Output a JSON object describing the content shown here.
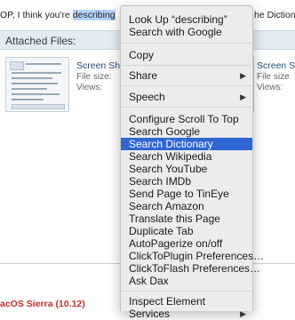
{
  "post": {
    "before": "OP, I think you're ",
    "highlight": "describing",
    "after": "he Dictiona"
  },
  "attached": {
    "header": "Attached Files:",
    "files": [
      {
        "name": "Screen Sh",
        "size_label": "File size:",
        "views_label": "Views:"
      },
      {
        "name": "Screen S",
        "size_label": "File size",
        "views_label": "Views:"
      }
    ]
  },
  "footer": {
    "text": "acOS Sierra (10.12)"
  },
  "context_menu": {
    "items": [
      {
        "label": "Look Up “describing”",
        "submenu": false,
        "selected": false
      },
      {
        "label": "Search with Google",
        "submenu": false,
        "selected": false
      },
      {
        "label": "Copy",
        "submenu": false,
        "selected": false
      },
      {
        "label": "Share",
        "submenu": true,
        "selected": false
      },
      {
        "label": "Speech",
        "submenu": true,
        "selected": false
      },
      {
        "label": "Configure Scroll To Top",
        "submenu": false,
        "selected": false
      },
      {
        "label": "Search Google",
        "submenu": false,
        "selected": false
      },
      {
        "label": "Search Dictionary",
        "submenu": false,
        "selected": true
      },
      {
        "label": "Search Wikipedia",
        "submenu": false,
        "selected": false
      },
      {
        "label": "Search YouTube",
        "submenu": false,
        "selected": false
      },
      {
        "label": "Search IMDb",
        "submenu": false,
        "selected": false
      },
      {
        "label": "Send Page to TinEye",
        "submenu": false,
        "selected": false
      },
      {
        "label": "Search Amazon",
        "submenu": false,
        "selected": false
      },
      {
        "label": "Translate this Page",
        "submenu": false,
        "selected": false
      },
      {
        "label": "Duplicate Tab",
        "submenu": false,
        "selected": false
      },
      {
        "label": "AutoPagerize on/off",
        "submenu": false,
        "selected": false
      },
      {
        "label": "ClickToPlugin Preferences…",
        "submenu": false,
        "selected": false
      },
      {
        "label": "ClickToFlash Preferences…",
        "submenu": false,
        "selected": false
      },
      {
        "label": "Ask Dax",
        "submenu": false,
        "selected": false
      },
      {
        "label": "Inspect Element",
        "submenu": false,
        "selected": false
      },
      {
        "label": "Services",
        "submenu": true,
        "selected": false
      }
    ],
    "submenu_glyph": "▶",
    "highlight_color": "#2e66d4"
  }
}
